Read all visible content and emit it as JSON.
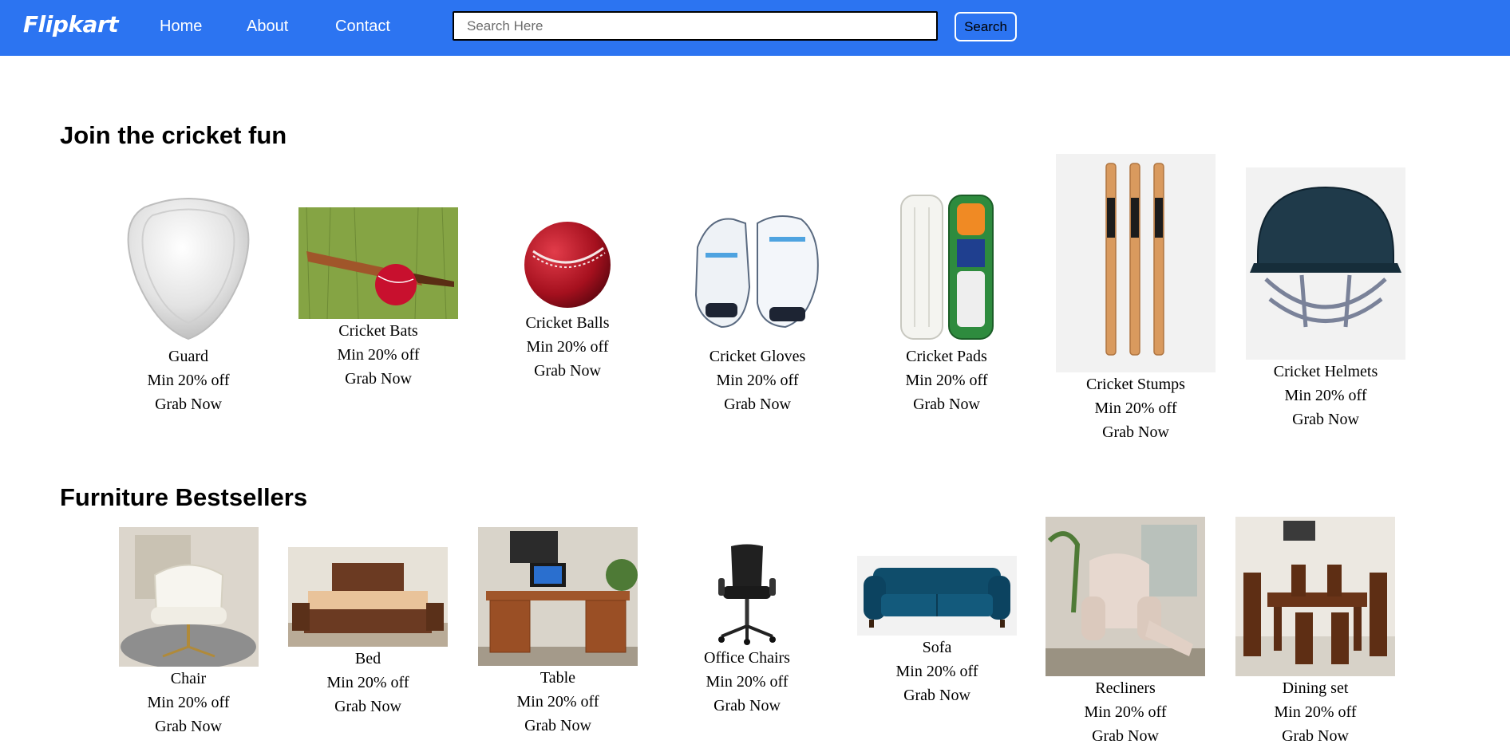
{
  "navbar": {
    "logo": "Flipkart",
    "links": [
      "Home",
      "About",
      "Contact"
    ],
    "search_placeholder": "Search Here",
    "search_button": "Search"
  },
  "cricket": {
    "title": "Join the cricket fun",
    "items": [
      {
        "name": "Guard",
        "offer": "Min 20% off",
        "cta": "Grab Now"
      },
      {
        "name": "Cricket Bats",
        "offer": "Min 20% off",
        "cta": "Grab Now"
      },
      {
        "name": "Cricket Balls",
        "offer": "Min 20% off",
        "cta": "Grab Now"
      },
      {
        "name": "Cricket Gloves",
        "offer": "Min 20% off",
        "cta": "Grab Now"
      },
      {
        "name": "Cricket Pads",
        "offer": "Min 20% off",
        "cta": "Grab Now"
      },
      {
        "name": "Cricket Stumps",
        "offer": "Min 20% off",
        "cta": "Grab Now"
      },
      {
        "name": "Cricket Helmets",
        "offer": "Min 20% off",
        "cta": "Grab Now"
      }
    ]
  },
  "furniture": {
    "title": "Furniture Bestsellers",
    "items": [
      {
        "name": "Chair",
        "offer": "Min 20% off",
        "cta": "Grab Now"
      },
      {
        "name": "Bed",
        "offer": "Min 20% off",
        "cta": "Grab Now"
      },
      {
        "name": "Table",
        "offer": "Min 20% off",
        "cta": "Grab Now"
      },
      {
        "name": "Office Chairs",
        "offer": "Min 20% off",
        "cta": "Grab Now"
      },
      {
        "name": "Sofa",
        "offer": "Min 20% off",
        "cta": "Grab Now"
      },
      {
        "name": "Recliners",
        "offer": "Min 20% off",
        "cta": "Grab Now"
      },
      {
        "name": "Dining set",
        "offer": "Min 20% off",
        "cta": "Grab Now"
      }
    ]
  },
  "colors": {
    "navbar": "#2c74f1"
  }
}
